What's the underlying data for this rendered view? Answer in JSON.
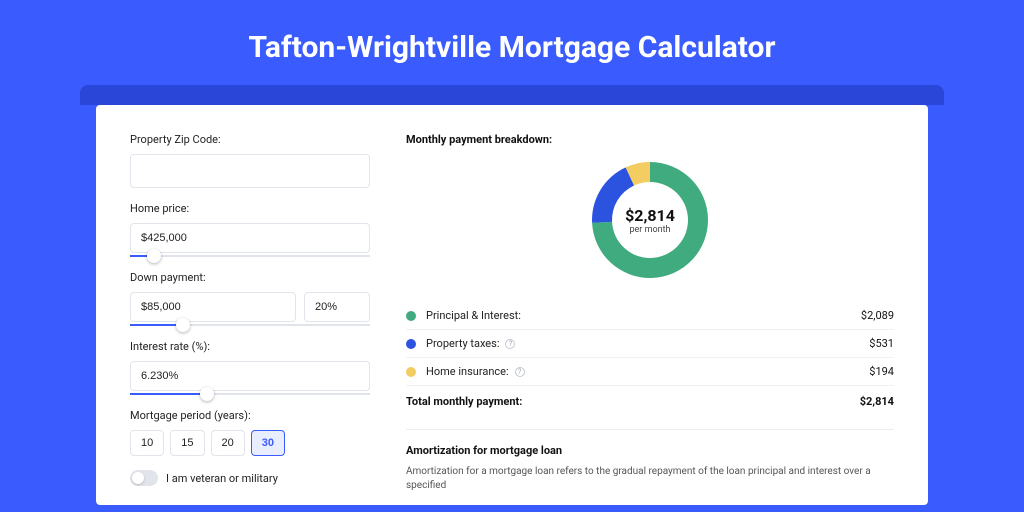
{
  "header": {
    "title": "Tafton-Wrightville Mortgage Calculator"
  },
  "form": {
    "zip": {
      "label": "Property Zip Code:",
      "value": ""
    },
    "home_price": {
      "label": "Home price:",
      "value": "$425,000",
      "slider_pct": 10
    },
    "down_payment": {
      "label": "Down payment:",
      "value": "$85,000",
      "pct_value": "20%",
      "slider_pct": 22
    },
    "interest_rate": {
      "label": "Interest rate (%):",
      "value": "6.230%",
      "slider_pct": 32
    },
    "mortgage_period": {
      "label": "Mortgage period (years):",
      "options": [
        "10",
        "15",
        "20",
        "30"
      ],
      "selected": "30"
    },
    "veteran": {
      "label": "I am veteran or military",
      "checked": false
    }
  },
  "breakdown": {
    "title": "Monthly payment breakdown:",
    "center_amount": "$2,814",
    "center_sub": "per month",
    "items": [
      {
        "label": "Principal & Interest:",
        "amount": "$2,089",
        "color": "#3fab7e",
        "info": false
      },
      {
        "label": "Property taxes:",
        "amount": "$531",
        "color": "#2b53e0",
        "info": true
      },
      {
        "label": "Home insurance:",
        "amount": "$194",
        "color": "#f3cd61",
        "info": true
      }
    ],
    "total_label": "Total monthly payment:",
    "total_amount": "$2,814"
  },
  "amort": {
    "title": "Amortization for mortgage loan",
    "body": "Amortization for a mortgage loan refers to the gradual repayment of the loan principal and interest over a specified"
  },
  "chart_data": {
    "type": "pie",
    "title": "Monthly payment breakdown",
    "series": [
      {
        "name": "Principal & Interest",
        "value": 2089,
        "color": "#3fab7e"
      },
      {
        "name": "Property taxes",
        "value": 531,
        "color": "#2b53e0"
      },
      {
        "name": "Home insurance",
        "value": 194,
        "color": "#f3cd61"
      }
    ],
    "total": 2814,
    "center_label": "$2,814 per month"
  }
}
